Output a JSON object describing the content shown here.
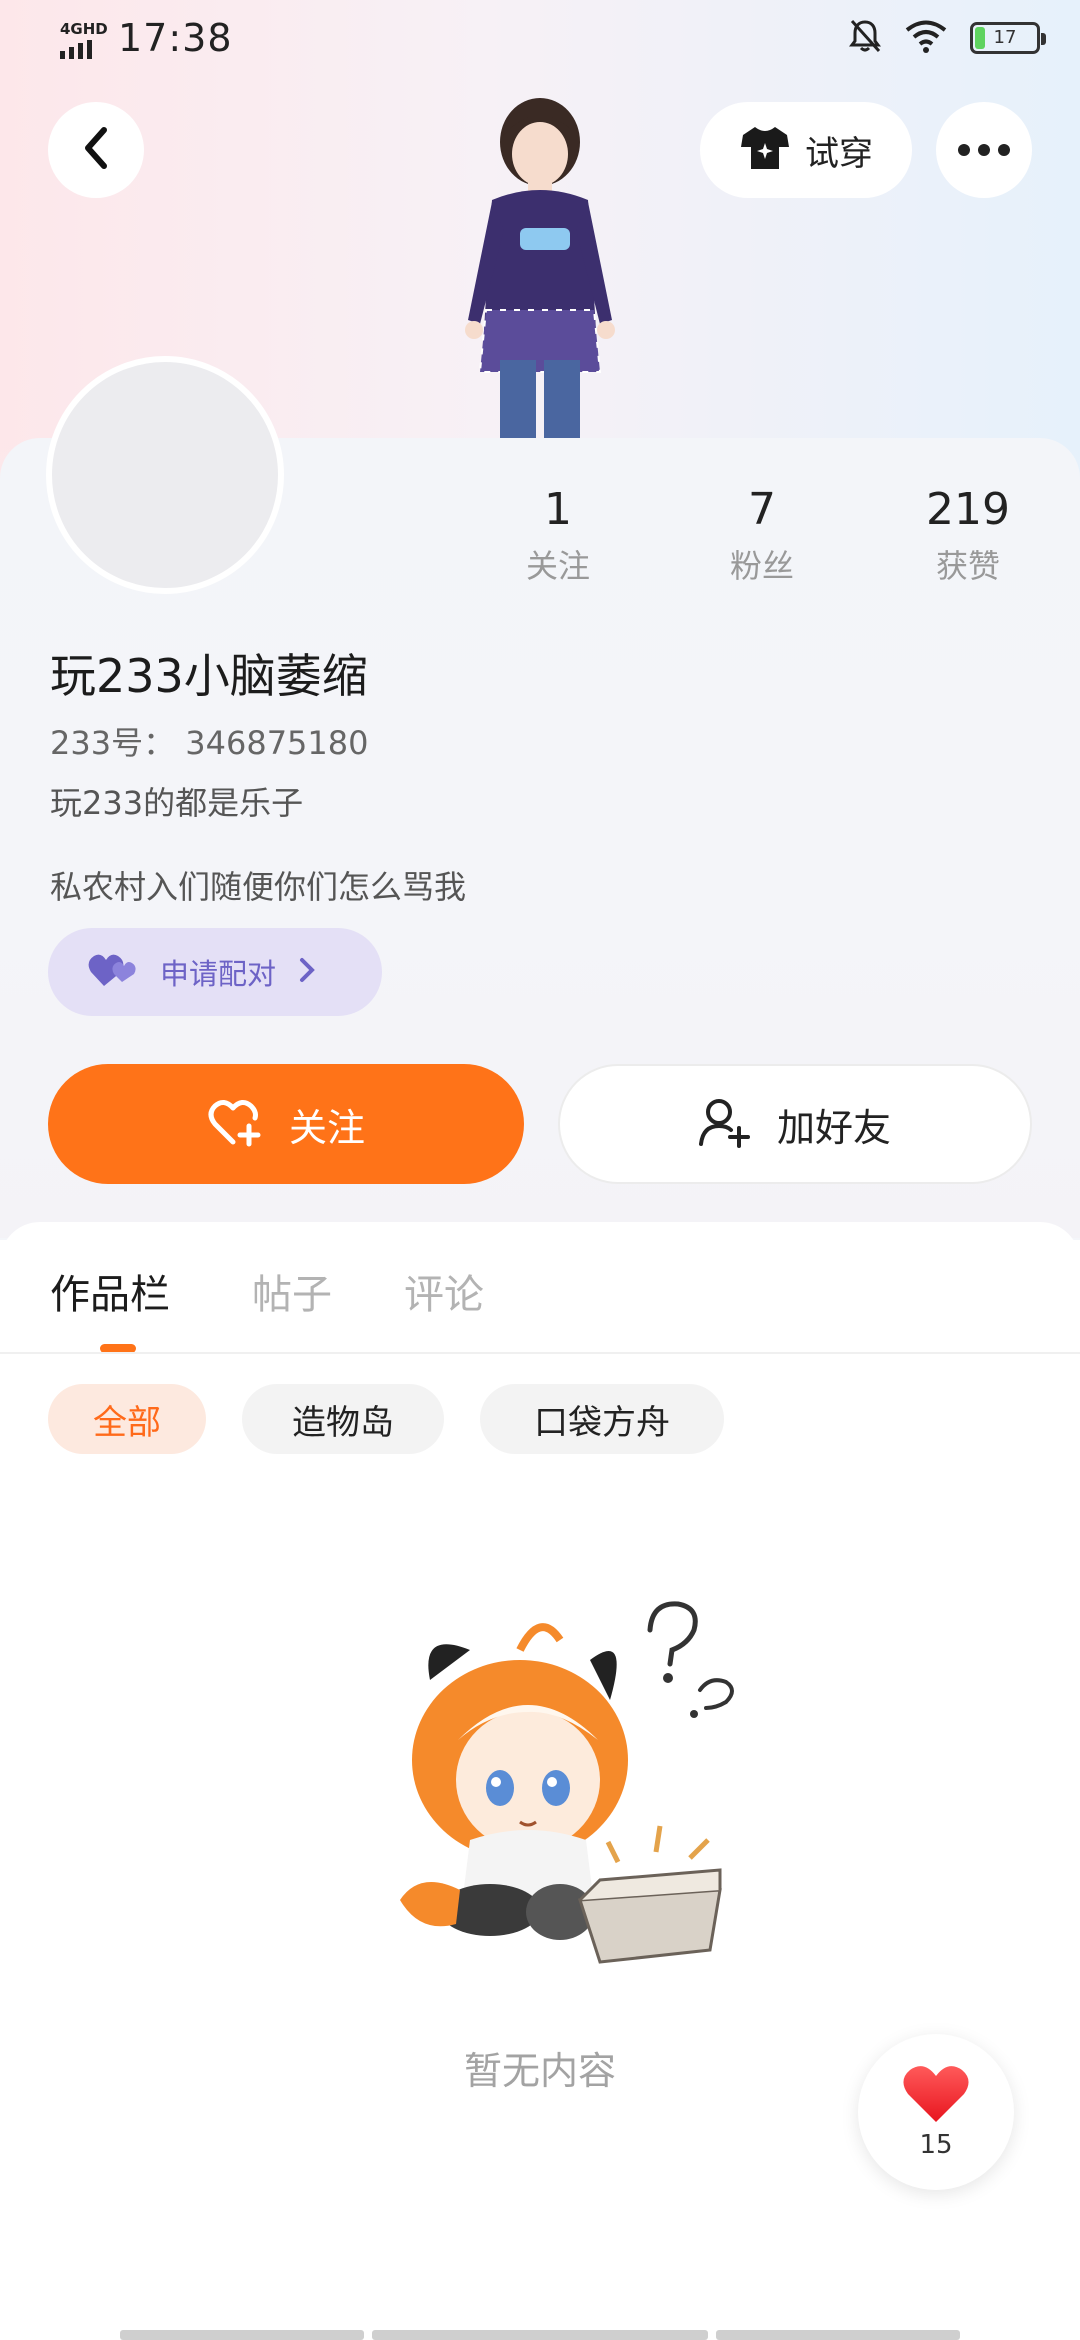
{
  "status_bar": {
    "network": "4GHD",
    "time": "17:38",
    "battery": "17",
    "battery_level": 0.17,
    "icons": [
      "bell-off-icon",
      "wifi-icon",
      "battery-icon"
    ]
  },
  "top_bar": {
    "back_icon": "chevron-left-icon",
    "tryon_label": "试穿",
    "tryon_icon": "tshirt-icon",
    "more_icon": "more-dots-icon"
  },
  "profile": {
    "stats": [
      {
        "value": "1",
        "label": "关注"
      },
      {
        "value": "7",
        "label": "粉丝"
      },
      {
        "value": "219",
        "label": "获赞"
      }
    ],
    "nickname": "玩233小脑萎缩",
    "uid": "233号： 346875180",
    "tagline": "玩233的都是乐子",
    "bio": "私农村入们随便你们怎么骂我",
    "pair_label": "申请配对"
  },
  "actions": {
    "follow_label": "关注",
    "add_friend_label": "加好友"
  },
  "tabs": [
    {
      "label": "作品栏",
      "active": true
    },
    {
      "label": "帖子",
      "active": false
    },
    {
      "label": "评论",
      "active": false
    }
  ],
  "filters": [
    {
      "label": "全部",
      "active": true
    },
    {
      "label": "造物岛",
      "active": false
    },
    {
      "label": "口袋方舟",
      "active": false
    }
  ],
  "empty_state": {
    "text": "暂无内容"
  },
  "like_button": {
    "count": "15"
  },
  "colors": {
    "accent": "#ff7318",
    "pair_bg": "#e4e0f6",
    "pair_text": "#6d63c6"
  }
}
